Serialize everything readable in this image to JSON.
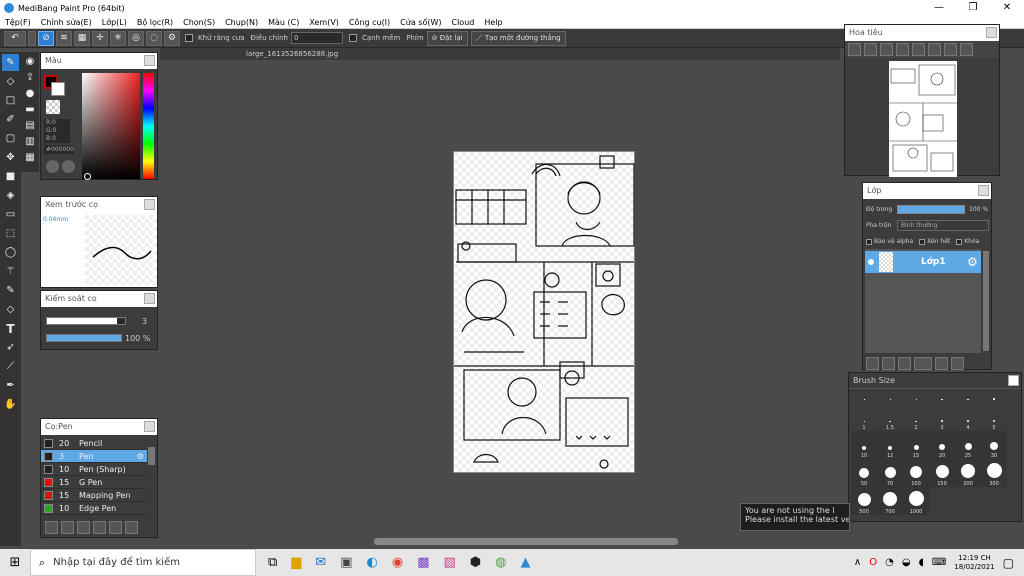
{
  "window": {
    "title": "MediBang Paint Pro (64bit)",
    "controls": [
      "—",
      "❐",
      "✕"
    ]
  },
  "menu": [
    "Tệp(F)",
    "Chỉnh sửa(E)",
    "Lớp(L)",
    "Bộ lọc(R)",
    "Chọn(S)",
    "Chụp(N)",
    "Màu (C)",
    "Xem(V)",
    "Công cụ(I)",
    "Cửa sổ(W)",
    "Cloud",
    "Help"
  ],
  "toolbar": {
    "antialias_label": "Khử răng cưa",
    "adjust_label": "Điều chỉnh",
    "adjust_value": "0",
    "edge_label": "Cạnh mềm",
    "keys_label": "Phím",
    "reset_label": "Đặt lại",
    "create_path_label": "Tạo một đường thẳng"
  },
  "file_tab": "large_1613526856288.jpg",
  "color_panel": {
    "title": "Màu",
    "r": "R:0",
    "g": "G:0",
    "b": "B:0",
    "hex": "#000000"
  },
  "brush_preview": {
    "title": "Xem trước cọ",
    "size": "0.04mm"
  },
  "brush_control": {
    "title": "Kiểm soát cọ",
    "size_value": "3",
    "opacity_value": "100 %",
    "size_level": 0.9,
    "opacity_level": 1.0
  },
  "brush_list": {
    "title": "Cọ:Pen",
    "items": [
      {
        "size": "20",
        "name": "Pencil",
        "color": "#222222",
        "active": false
      },
      {
        "size": "3",
        "name": "Pen",
        "color": "#222222",
        "active": true
      },
      {
        "size": "10",
        "name": "Pen (Sharp)",
        "color": "#222222",
        "active": false
      },
      {
        "size": "15",
        "name": "G Pen",
        "color": "#dd1111",
        "active": false
      },
      {
        "size": "15",
        "name": "Mapping Pen",
        "color": "#dd1111",
        "active": false
      },
      {
        "size": "10",
        "name": "Edge Pen",
        "color": "#22aa22",
        "active": false
      }
    ]
  },
  "navigator": {
    "title": "Hoa tiêu"
  },
  "layer_panel": {
    "title": "Lớp",
    "opacity_label": "Độ trong",
    "opacity_value": "100 %",
    "blend_label": "Pha trộn",
    "blend_value": "Bình thường",
    "protect_alpha": "Bảo vệ alpha",
    "clipping": "Xén hết",
    "lock": "Khóa",
    "layer_name": "Lớp1"
  },
  "brush_size": {
    "title": "Brush Size",
    "row0": [
      "",
      "",
      "",
      "",
      "",
      ""
    ],
    "labels": [
      "1",
      "1.5",
      "2",
      "3",
      "4",
      "5",
      "10",
      "12",
      "15",
      "20",
      "25",
      "30",
      "50",
      "70",
      "100",
      "150",
      "200",
      "300",
      "500",
      "700",
      "1000"
    ]
  },
  "notice": {
    "line1": "You are not using the l",
    "line2": "Please install the latest ve"
  },
  "taskbar": {
    "search_placeholder": "Nhập tại đây để tìm kiếm",
    "time": "12:19 CH",
    "date": "18/02/2021"
  }
}
